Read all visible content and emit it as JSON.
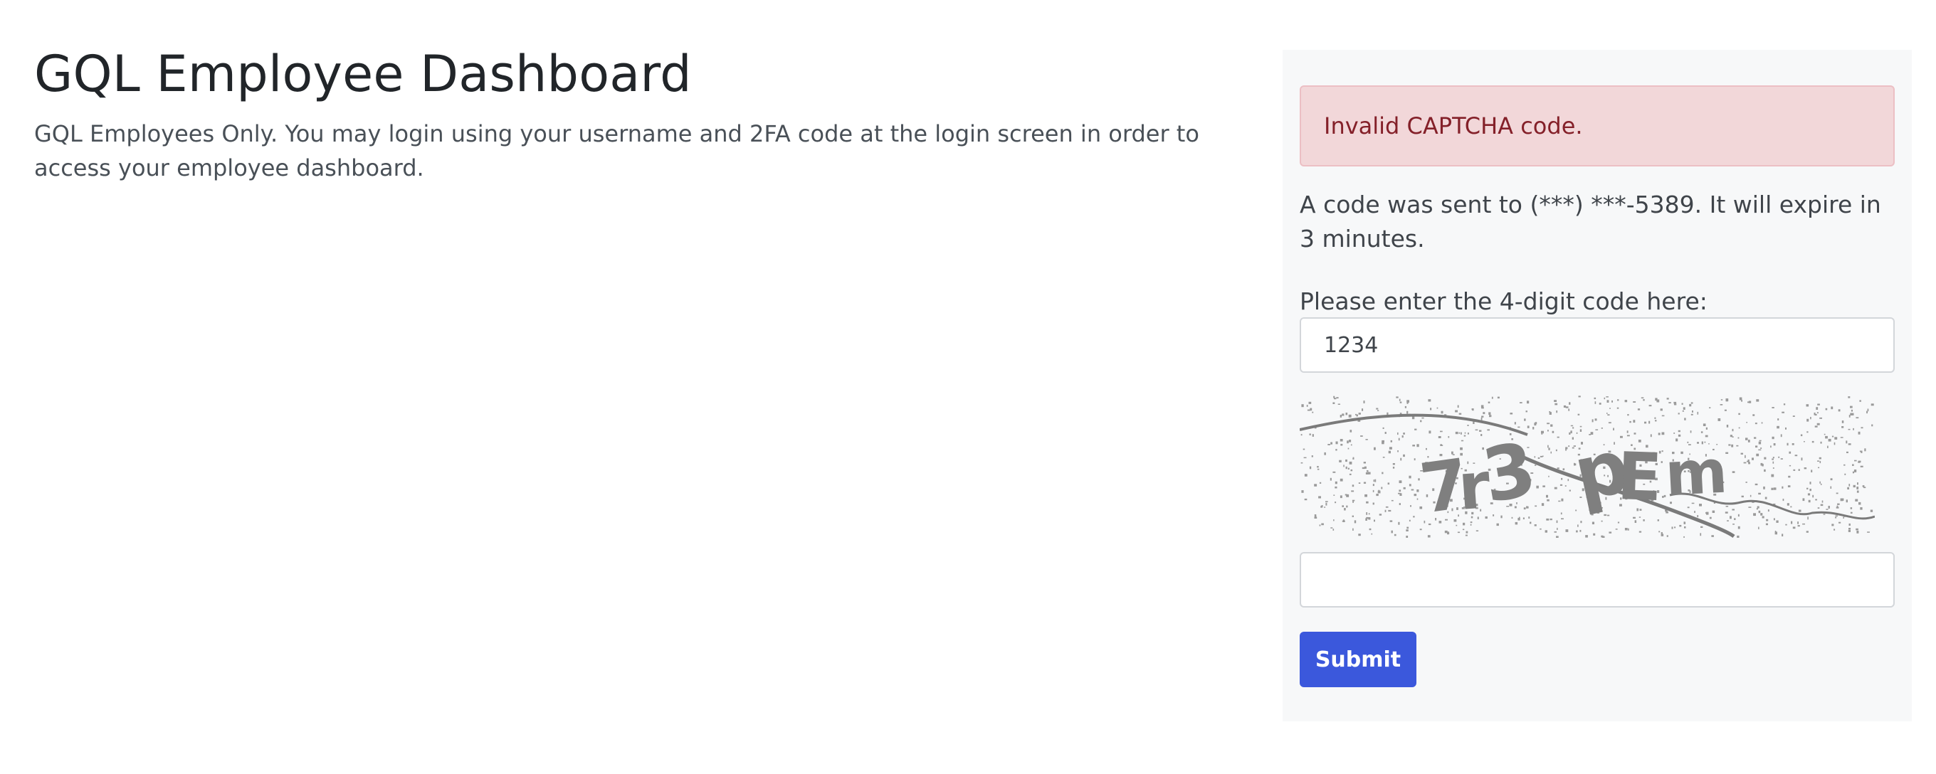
{
  "header": {
    "title": "GQL Employee Dashboard",
    "description": "GQL Employees Only. You may login using your username and 2FA code at the login screen in order to access your employee dashboard."
  },
  "panel": {
    "alert_text": "Invalid CAPTCHA code.",
    "sent_message": "A code was sent to (***) ***-5389. It will expire in 3 minutes.",
    "code_label": "Please enter the 4-digit code here:",
    "code_value": "1234",
    "captcha_image_text": "7r3 pEm",
    "captcha_value": "",
    "submit_label": "Submit"
  },
  "colors": {
    "accent": "#3b58dc",
    "alert_background": "#f2d7d9",
    "alert_text": "#842029",
    "panel_background": "#f7f8f9"
  },
  "icons": []
}
